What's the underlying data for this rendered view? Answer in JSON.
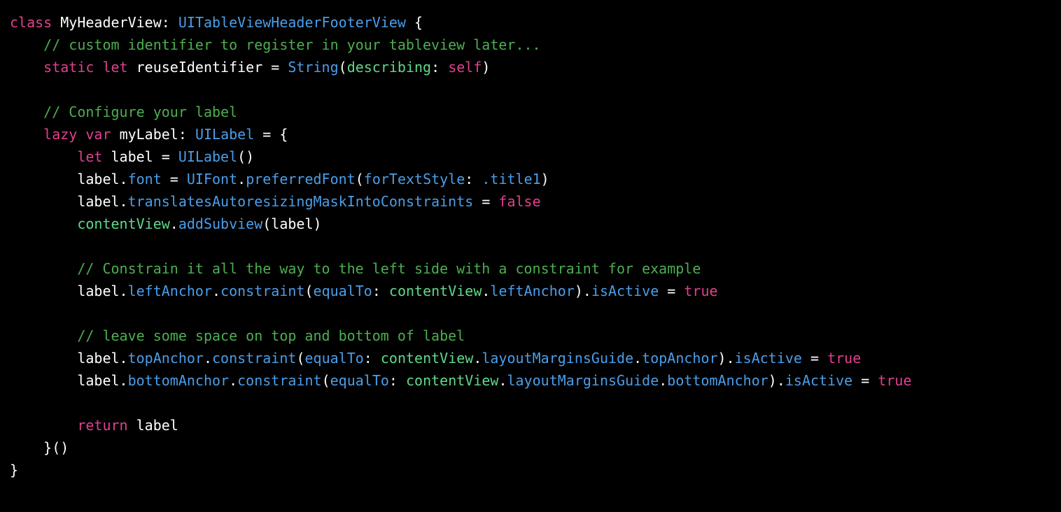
{
  "editor": {
    "language": "Swift",
    "background_color": "#000000",
    "foreground_color": "#ffffff",
    "palette": {
      "keyword": "#e0408f",
      "type": "#4a9eea",
      "member": "#4a9eea",
      "comment": "#4caf50",
      "property": "#5fd98a",
      "argument_label": "#5fd98a",
      "plain": "#ffffff"
    }
  },
  "code": {
    "lines": [
      {
        "index": 1,
        "text": "class MyHeaderView: UITableViewHeaderFooterView {",
        "tokens": [
          {
            "t": "class",
            "c": "kw"
          },
          {
            "t": " ",
            "c": "plain"
          },
          {
            "t": "MyHeaderView",
            "c": "plain"
          },
          {
            "t": ": ",
            "c": "punct"
          },
          {
            "t": "UITableViewHeaderFooterView",
            "c": "type"
          },
          {
            "t": " {",
            "c": "punct"
          }
        ]
      },
      {
        "index": 2,
        "text": "    // custom identifier to register in your tableview later...",
        "tokens": [
          {
            "t": "    ",
            "c": "plain"
          },
          {
            "t": "// custom identifier to register in your tableview later...",
            "c": "comment"
          }
        ]
      },
      {
        "index": 3,
        "text": "    static let reuseIdentifier = String(describing: self)",
        "tokens": [
          {
            "t": "    ",
            "c": "plain"
          },
          {
            "t": "static",
            "c": "kw"
          },
          {
            "t": " ",
            "c": "plain"
          },
          {
            "t": "let",
            "c": "kw"
          },
          {
            "t": " ",
            "c": "plain"
          },
          {
            "t": "reuseIdentifier",
            "c": "plain"
          },
          {
            "t": " = ",
            "c": "punct"
          },
          {
            "t": "String",
            "c": "type"
          },
          {
            "t": "(",
            "c": "punct"
          },
          {
            "t": "describing",
            "c": "arglbl"
          },
          {
            "t": ": ",
            "c": "punct"
          },
          {
            "t": "self",
            "c": "kw"
          },
          {
            "t": ")",
            "c": "punct"
          }
        ]
      },
      {
        "index": 4,
        "text": "",
        "tokens": []
      },
      {
        "index": 5,
        "text": "    // Configure your label",
        "tokens": [
          {
            "t": "    ",
            "c": "plain"
          },
          {
            "t": "// Configure your label",
            "c": "comment"
          }
        ]
      },
      {
        "index": 6,
        "text": "    lazy var myLabel: UILabel = {",
        "tokens": [
          {
            "t": "    ",
            "c": "plain"
          },
          {
            "t": "lazy",
            "c": "kw"
          },
          {
            "t": " ",
            "c": "plain"
          },
          {
            "t": "var",
            "c": "kw"
          },
          {
            "t": " ",
            "c": "plain"
          },
          {
            "t": "myLabel",
            "c": "plain"
          },
          {
            "t": ": ",
            "c": "punct"
          },
          {
            "t": "UILabel",
            "c": "type"
          },
          {
            "t": " = {",
            "c": "punct"
          }
        ]
      },
      {
        "index": 7,
        "text": "        let label = UILabel()",
        "tokens": [
          {
            "t": "        ",
            "c": "plain"
          },
          {
            "t": "let",
            "c": "kw"
          },
          {
            "t": " ",
            "c": "plain"
          },
          {
            "t": "label",
            "c": "plain"
          },
          {
            "t": " = ",
            "c": "punct"
          },
          {
            "t": "UILabel",
            "c": "type"
          },
          {
            "t": "()",
            "c": "punct"
          }
        ]
      },
      {
        "index": 8,
        "text": "        label.font = UIFont.preferredFont(forTextStyle: .title1)",
        "tokens": [
          {
            "t": "        ",
            "c": "plain"
          },
          {
            "t": "label",
            "c": "plain"
          },
          {
            "t": ".",
            "c": "punct"
          },
          {
            "t": "font",
            "c": "member"
          },
          {
            "t": " = ",
            "c": "punct"
          },
          {
            "t": "UIFont",
            "c": "type"
          },
          {
            "t": ".",
            "c": "punct"
          },
          {
            "t": "preferredFont",
            "c": "member"
          },
          {
            "t": "(",
            "c": "punct"
          },
          {
            "t": "forTextStyle",
            "c": "member"
          },
          {
            "t": ": ",
            "c": "punct"
          },
          {
            "t": ".title1",
            "c": "member"
          },
          {
            "t": ")",
            "c": "punct"
          }
        ]
      },
      {
        "index": 9,
        "text": "        label.translatesAutoresizingMaskIntoConstraints = false",
        "tokens": [
          {
            "t": "        ",
            "c": "plain"
          },
          {
            "t": "label",
            "c": "plain"
          },
          {
            "t": ".",
            "c": "punct"
          },
          {
            "t": "translatesAutoresizingMaskIntoConstraints",
            "c": "member"
          },
          {
            "t": " = ",
            "c": "punct"
          },
          {
            "t": "false",
            "c": "kw"
          }
        ]
      },
      {
        "index": 10,
        "text": "        contentView.addSubview(label)",
        "tokens": [
          {
            "t": "        ",
            "c": "plain"
          },
          {
            "t": "contentView",
            "c": "prop"
          },
          {
            "t": ".",
            "c": "punct"
          },
          {
            "t": "addSubview",
            "c": "member"
          },
          {
            "t": "(",
            "c": "punct"
          },
          {
            "t": "label",
            "c": "plain"
          },
          {
            "t": ")",
            "c": "punct"
          }
        ]
      },
      {
        "index": 11,
        "text": "",
        "tokens": []
      },
      {
        "index": 12,
        "text": "        // Constrain it all the way to the left side with a constraint for example",
        "tokens": [
          {
            "t": "        ",
            "c": "plain"
          },
          {
            "t": "// Constrain it all the way to the left side with a constraint for example",
            "c": "comment"
          }
        ]
      },
      {
        "index": 13,
        "text": "        label.leftAnchor.constraint(equalTo: contentView.leftAnchor).isActive = true",
        "tokens": [
          {
            "t": "        ",
            "c": "plain"
          },
          {
            "t": "label",
            "c": "plain"
          },
          {
            "t": ".",
            "c": "punct"
          },
          {
            "t": "leftAnchor",
            "c": "member"
          },
          {
            "t": ".",
            "c": "punct"
          },
          {
            "t": "constraint",
            "c": "member"
          },
          {
            "t": "(",
            "c": "punct"
          },
          {
            "t": "equalTo",
            "c": "member"
          },
          {
            "t": ": ",
            "c": "punct"
          },
          {
            "t": "contentView",
            "c": "prop"
          },
          {
            "t": ".",
            "c": "punct"
          },
          {
            "t": "leftAnchor",
            "c": "member"
          },
          {
            "t": ")",
            "c": "punct"
          },
          {
            "t": ".",
            "c": "punct"
          },
          {
            "t": "isActive",
            "c": "member"
          },
          {
            "t": " = ",
            "c": "punct"
          },
          {
            "t": "true",
            "c": "kw"
          }
        ]
      },
      {
        "index": 14,
        "text": "",
        "tokens": []
      },
      {
        "index": 15,
        "text": "        // leave some space on top and bottom of label",
        "tokens": [
          {
            "t": "        ",
            "c": "plain"
          },
          {
            "t": "// leave some space on top and bottom of label",
            "c": "comment"
          }
        ]
      },
      {
        "index": 16,
        "text": "        label.topAnchor.constraint(equalTo: contentView.layoutMarginsGuide.topAnchor).isActive = true",
        "tokens": [
          {
            "t": "        ",
            "c": "plain"
          },
          {
            "t": "label",
            "c": "plain"
          },
          {
            "t": ".",
            "c": "punct"
          },
          {
            "t": "topAnchor",
            "c": "member"
          },
          {
            "t": ".",
            "c": "punct"
          },
          {
            "t": "constraint",
            "c": "member"
          },
          {
            "t": "(",
            "c": "punct"
          },
          {
            "t": "equalTo",
            "c": "member"
          },
          {
            "t": ": ",
            "c": "punct"
          },
          {
            "t": "contentView",
            "c": "prop"
          },
          {
            "t": ".",
            "c": "punct"
          },
          {
            "t": "layoutMarginsGuide",
            "c": "member"
          },
          {
            "t": ".",
            "c": "punct"
          },
          {
            "t": "topAnchor",
            "c": "member"
          },
          {
            "t": ")",
            "c": "punct"
          },
          {
            "t": ".",
            "c": "punct"
          },
          {
            "t": "isActive",
            "c": "member"
          },
          {
            "t": " = ",
            "c": "punct"
          },
          {
            "t": "true",
            "c": "kw"
          }
        ]
      },
      {
        "index": 17,
        "text": "        label.bottomAnchor.constraint(equalTo: contentView.layoutMarginsGuide.bottomAnchor).isActive = true",
        "tokens": [
          {
            "t": "        ",
            "c": "plain"
          },
          {
            "t": "label",
            "c": "plain"
          },
          {
            "t": ".",
            "c": "punct"
          },
          {
            "t": "bottomAnchor",
            "c": "member"
          },
          {
            "t": ".",
            "c": "punct"
          },
          {
            "t": "constraint",
            "c": "member"
          },
          {
            "t": "(",
            "c": "punct"
          },
          {
            "t": "equalTo",
            "c": "member"
          },
          {
            "t": ": ",
            "c": "punct"
          },
          {
            "t": "contentView",
            "c": "prop"
          },
          {
            "t": ".",
            "c": "punct"
          },
          {
            "t": "layoutMarginsGuide",
            "c": "member"
          },
          {
            "t": ".",
            "c": "punct"
          },
          {
            "t": "bottomAnchor",
            "c": "member"
          },
          {
            "t": ")",
            "c": "punct"
          },
          {
            "t": ".",
            "c": "punct"
          },
          {
            "t": "isActive",
            "c": "member"
          },
          {
            "t": " = ",
            "c": "punct"
          },
          {
            "t": "true",
            "c": "kw"
          }
        ]
      },
      {
        "index": 18,
        "text": "",
        "tokens": []
      },
      {
        "index": 19,
        "text": "        return label",
        "tokens": [
          {
            "t": "        ",
            "c": "plain"
          },
          {
            "t": "return",
            "c": "kw"
          },
          {
            "t": " ",
            "c": "plain"
          },
          {
            "t": "label",
            "c": "plain"
          }
        ]
      },
      {
        "index": 20,
        "text": "    }()",
        "tokens": [
          {
            "t": "    ",
            "c": "plain"
          },
          {
            "t": "}()",
            "c": "punct"
          }
        ]
      },
      {
        "index": 21,
        "text": "}",
        "tokens": [
          {
            "t": "}",
            "c": "punct"
          }
        ]
      }
    ]
  }
}
